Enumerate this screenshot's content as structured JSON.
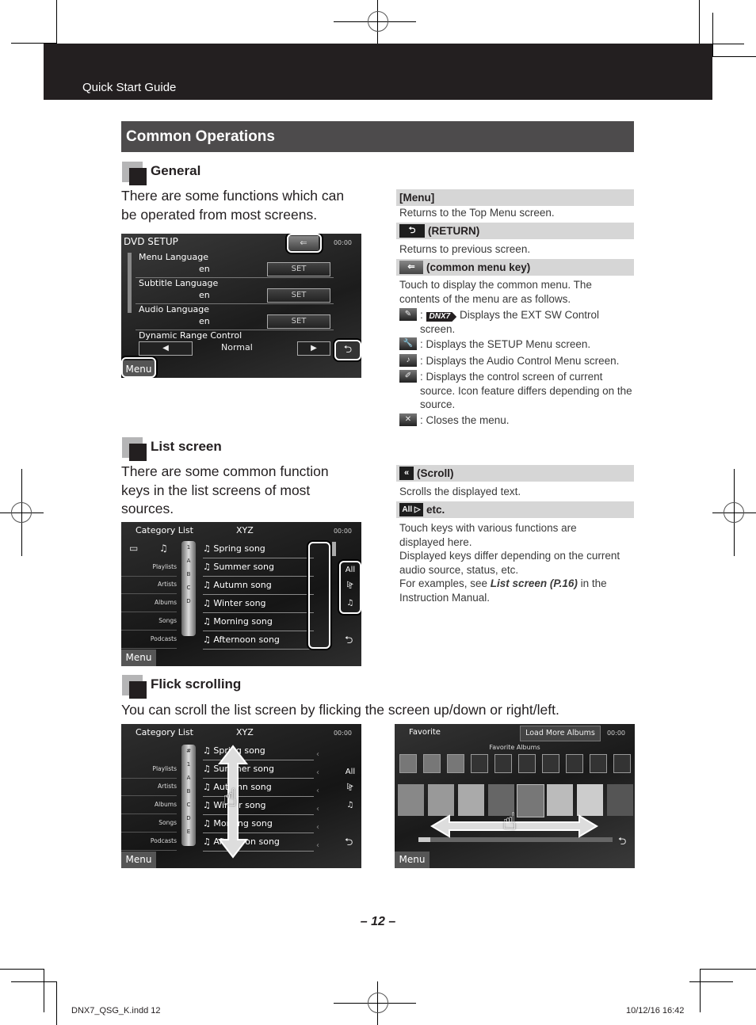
{
  "header": {
    "title": "Quick Start Guide"
  },
  "section": {
    "title": "Common Operations"
  },
  "general": {
    "heading": "General",
    "intro": [
      "There are some functions which can",
      "be operated from most screens."
    ],
    "screen": {
      "title": "DVD SETUP",
      "clock": "00:00",
      "rows": [
        {
          "label": "Menu Language",
          "value": "en",
          "button": "SET"
        },
        {
          "label": "Subtitle Language",
          "value": "en",
          "button": "SET"
        },
        {
          "label": "Audio Language",
          "value": "en",
          "button": "SET"
        },
        {
          "label": "Dynamic Range Control",
          "value": "Normal",
          "prev": "◀",
          "next": "▶"
        }
      ],
      "menu_button": "Menu",
      "return_icon": "⮌",
      "common_menu_icon": "⇐"
    },
    "keys": [
      {
        "title": "[Menu]",
        "desc": "Returns to the Top Menu screen."
      },
      {
        "title": "(RETURN)",
        "desc": "Returns to previous screen."
      },
      {
        "title": "(common menu key)",
        "desc_lines": [
          "Touch to display the common menu. The",
          "contents of the menu are as follows."
        ]
      }
    ],
    "menu_items": [
      {
        "icon": "ext-sw-icon",
        "glyph": "✎",
        "badge": "DNX7",
        "text": "Displays the EXT SW Control screen."
      },
      {
        "icon": "setup-wrench-icon",
        "glyph": "🔧",
        "text": ": Displays the SETUP Menu screen."
      },
      {
        "icon": "audio-ear-icon",
        "glyph": "♪",
        "text": ": Displays the Audio Control Menu screen."
      },
      {
        "icon": "source-control-pencil-icon",
        "glyph": "✐",
        "text": ": Displays the control screen of current source. Icon feature differs depending on the source."
      },
      {
        "icon": "close-x-icon",
        "glyph": "✕",
        "text": ": Closes the menu."
      }
    ]
  },
  "list_screen": {
    "heading": "List screen",
    "intro": [
      "There are some common function",
      "keys in the list screens of most",
      "sources."
    ],
    "screen": {
      "title": "Category List",
      "center": "XYZ",
      "clock": "00:00",
      "categories": [
        "Playlists",
        "Artists",
        "Albums",
        "Songs",
        "Podcasts"
      ],
      "alpha": [
        "#",
        "1",
        "A",
        "B",
        "C",
        "D",
        "E"
      ],
      "songs": [
        "Spring song",
        "Summer song",
        "Autumn song",
        "Winter song",
        "Morning song",
        "Afternoon song"
      ],
      "side_keys": [
        "All ▷",
        "⇧",
        "♫"
      ],
      "menu_button": "Menu"
    },
    "keys": [
      {
        "title": "(Scroll)",
        "icon": "«",
        "desc": "Scrolls the displayed text."
      },
      {
        "title": "etc.",
        "icon": "All ▷",
        "desc_lines": [
          "Touch keys with various functions are",
          "displayed here.",
          "Displayed keys differ depending on the current",
          "audio source, status, etc."
        ]
      }
    ],
    "ref": {
      "prefix": "For examples, see ",
      "link": "List screen (P.16)",
      "suffix": " in the",
      "line2": "Instruction Manual."
    }
  },
  "flick": {
    "heading": "Flick scrolling",
    "intro": "You can scroll the list screen by flicking the screen up/down or right/left.",
    "screen2": {
      "title": "Favorite",
      "load_more": "Load More Albums",
      "clock": "00:00",
      "subtitle": "Favorite Albums",
      "menu_button": "Menu"
    }
  },
  "footer": {
    "page": "12",
    "file": "DNX7_QSG_K.indd  12",
    "timestamp": "10/12/16  16:42"
  }
}
